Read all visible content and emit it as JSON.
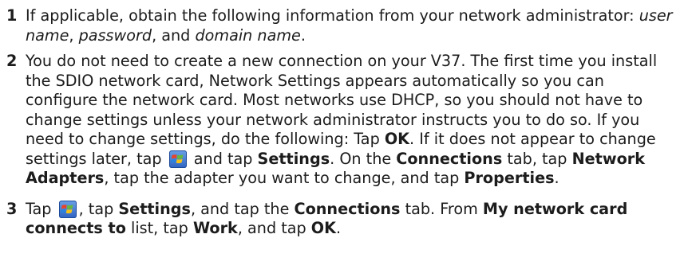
{
  "steps": [
    {
      "number": "1",
      "t1": "If applicable, obtain the following information from your network administrator: ",
      "i1": "user name",
      "t2": ", ",
      "i2": "password",
      "t3": ", and ",
      "i3": "domain name",
      "t4": "."
    },
    {
      "number": "2",
      "t1": "You do not need to create a new connection on your V37. The first time you install the SDIO network card, Network Settings appears automatically so you can configure the network card. Most networks use DHCP, so you should not have to change settings unless your network administrator instructs you to do so. If you need to change settings, do the following: Tap ",
      "b1": "OK",
      "t2": ". If it does not appear to change settings later, tap ",
      "t3": " and tap ",
      "b2": "Settings",
      "t4": ". On the ",
      "b3": "Connections",
      "t5": " tab, tap ",
      "b4": "Network Adapters",
      "t6": ", tap the adapter you want to change, and tap ",
      "b5": "Properties",
      "t7": "."
    },
    {
      "number": "3",
      "t1": "Tap ",
      "t2": ", tap ",
      "b1": "Settings",
      "t3": ", and tap the ",
      "b2": "Connections",
      "t4": " tab. From ",
      "b3": "My network card connects to",
      "t5": " list, tap ",
      "b4": "Work",
      "t6": ", and tap ",
      "b5": "OK",
      "t7": "."
    }
  ],
  "icons": {
    "start_icon": "windows-start-icon"
  }
}
